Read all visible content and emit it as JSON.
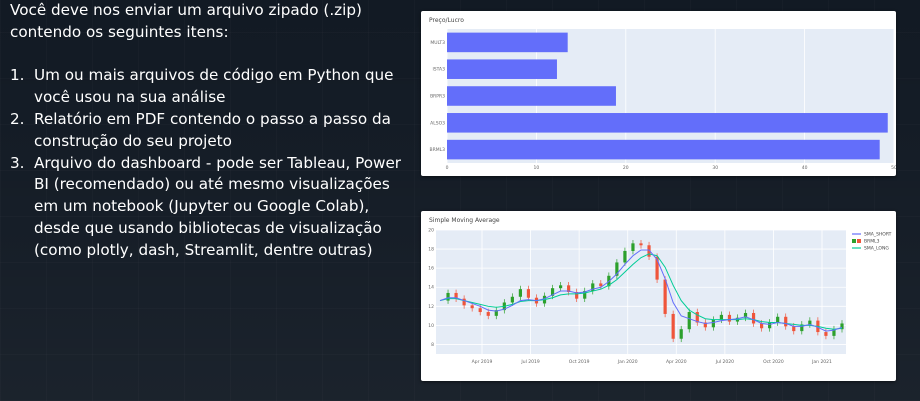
{
  "slide": {
    "intro": "Você deve nos enviar um arquivo zipado (.zip) contendo os seguintes itens:",
    "items": [
      {
        "num": "1.",
        "text": "Um ou mais arquivos de código em Python que você usou na sua análise"
      },
      {
        "num": "2.",
        "text": "Relatório em PDF contendo o passo a passo da construção do seu projeto"
      },
      {
        "num": "3.",
        "text": "Arquivo do dashboard - pode ser Tableau, Power BI (recomendado) ou até mesmo visualizações em um notebook (Jupyter ou Google Colab), desde que usando bibliotecas de visualização (como plotly, dash, Streamlit, dentre outras)"
      }
    ]
  },
  "chart_data": [
    {
      "type": "bar",
      "orientation": "horizontal",
      "title": "Preço/Lucro",
      "categories": [
        "MULT3",
        "ISTA3",
        "BRPR3",
        "ALSO3",
        "BRML3"
      ],
      "values": [
        13.5,
        12.3,
        18.9,
        49.3,
        48.4
      ],
      "xlim": [
        0,
        50
      ],
      "xticks": [
        0,
        10,
        20,
        30,
        40,
        50
      ],
      "bar_color": "#636efa",
      "plot_bg": "#e5ecf6",
      "grid": true
    },
    {
      "type": "line",
      "title": "Simple Moving Average",
      "ylim": [
        7,
        20
      ],
      "yticks": [
        8,
        10,
        12,
        14,
        16,
        18,
        20
      ],
      "xtick_labels": [
        "Apr 2019",
        "Jul 2019",
        "Oct 2019",
        "Jan 2020",
        "Apr 2020",
        "Jul 2020",
        "Oct 2020",
        "Jan 2021"
      ],
      "legend": [
        "SMA_SHORT",
        "BRML3",
        "SMA_LONG"
      ],
      "legend_position": "top-right",
      "colors": {
        "sma_short": "#636efa",
        "sma_long": "#00cc96",
        "candle_up": "#2ca02c",
        "candle_down": "#ef553b"
      },
      "grid": true,
      "series": [
        {
          "name": "BRML3",
          "values": [
            12.6,
            13.4,
            12.8,
            12.1,
            11.8,
            11.4,
            11.0,
            11.6,
            12.4,
            13.0,
            13.8,
            12.9,
            12.3,
            13.1,
            13.9,
            14.2,
            13.5,
            12.8,
            13.6,
            14.4,
            14.1,
            15.2,
            16.6,
            17.8,
            18.6,
            18.4,
            17.2,
            14.8,
            11.2,
            8.6,
            9.6,
            11.4,
            10.3,
            9.8,
            10.6,
            11.1,
            10.4,
            10.8,
            11.3,
            10.2,
            9.7,
            10.3,
            10.9,
            9.9,
            9.4,
            10.1,
            10.5,
            9.3,
            8.9,
            9.6,
            10.2
          ]
        },
        {
          "name": "SMA_SHORT",
          "values": [
            12.6,
            12.9,
            12.9,
            12.6,
            12.3,
            12.0,
            11.6,
            11.5,
            11.7,
            12.1,
            12.6,
            12.7,
            12.6,
            12.8,
            13.2,
            13.6,
            13.6,
            13.4,
            13.5,
            13.8,
            14.0,
            14.6,
            15.4,
            16.4,
            17.3,
            17.9,
            17.9,
            16.9,
            14.9,
            12.4,
            11.0,
            10.7,
            10.4,
            10.2,
            10.3,
            10.5,
            10.6,
            10.7,
            10.9,
            10.6,
            10.2,
            10.1,
            10.3,
            10.2,
            9.9,
            9.9,
            10.1,
            9.8,
            9.4,
            9.5,
            9.8
          ]
        },
        {
          "name": "SMA_LONG",
          "values": [
            12.6,
            12.8,
            12.8,
            12.6,
            12.4,
            12.2,
            12.0,
            11.9,
            12.0,
            12.2,
            12.5,
            12.6,
            12.6,
            12.7,
            12.9,
            13.2,
            13.3,
            13.3,
            13.4,
            13.6,
            13.8,
            14.2,
            14.8,
            15.6,
            16.4,
            17.1,
            17.5,
            17.3,
            16.1,
            14.2,
            12.6,
            11.6,
            11.1,
            10.7,
            10.6,
            10.6,
            10.6,
            10.6,
            10.7,
            10.6,
            10.4,
            10.3,
            10.3,
            10.2,
            10.1,
            10.0,
            10.0,
            9.9,
            9.7,
            9.6,
            9.7
          ]
        }
      ]
    }
  ]
}
